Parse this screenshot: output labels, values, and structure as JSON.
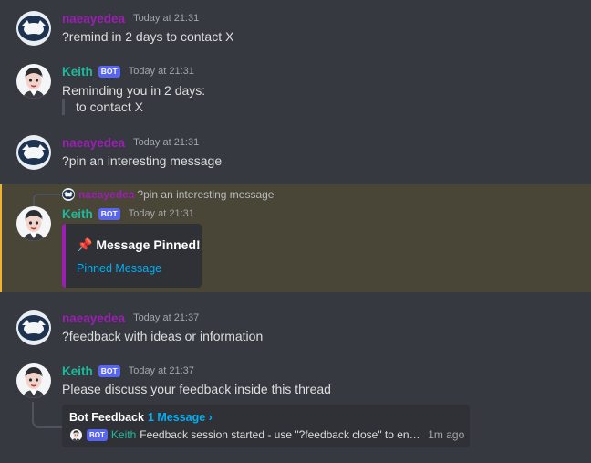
{
  "messages": [
    {
      "author": "naeayedea",
      "time": "Today at 21:31",
      "text": "?remind in 2 days to contact X"
    },
    {
      "author": "Keith",
      "bot": "BOT",
      "time": "Today at 21:31",
      "text": "Reminding you in 2 days:",
      "quote": "to contact X"
    },
    {
      "author": "naeayedea",
      "time": "Today at 21:31",
      "text": "?pin an interesting message"
    },
    {
      "author": "Keith",
      "bot": "BOT",
      "time": "Today at 21:31",
      "reply": {
        "author": "naeayedea",
        "text": "?pin an interesting message"
      },
      "embed": {
        "title": "📌 Message Pinned!",
        "link": "Pinned Message"
      }
    },
    {
      "author": "naeayedea",
      "time": "Today at 21:37",
      "text": "?feedback with ideas or information"
    },
    {
      "author": "Keith",
      "bot": "BOT",
      "time": "Today at 21:37",
      "text": "Please discuss your feedback inside this thread",
      "thread": {
        "title": "Bot Feedback",
        "count": "1 Message ›",
        "bot": "BOT",
        "author": "Keith",
        "preview": "Feedback session started - use \"?feedback close\" to end the session",
        "ago": "1m ago"
      }
    }
  ],
  "colors": {
    "user": "#9b1fb3",
    "bot_name": "#1abc9c",
    "bot_tag": "#5865f2",
    "highlight_bar": "#f0b232",
    "link": "#00aff4"
  }
}
